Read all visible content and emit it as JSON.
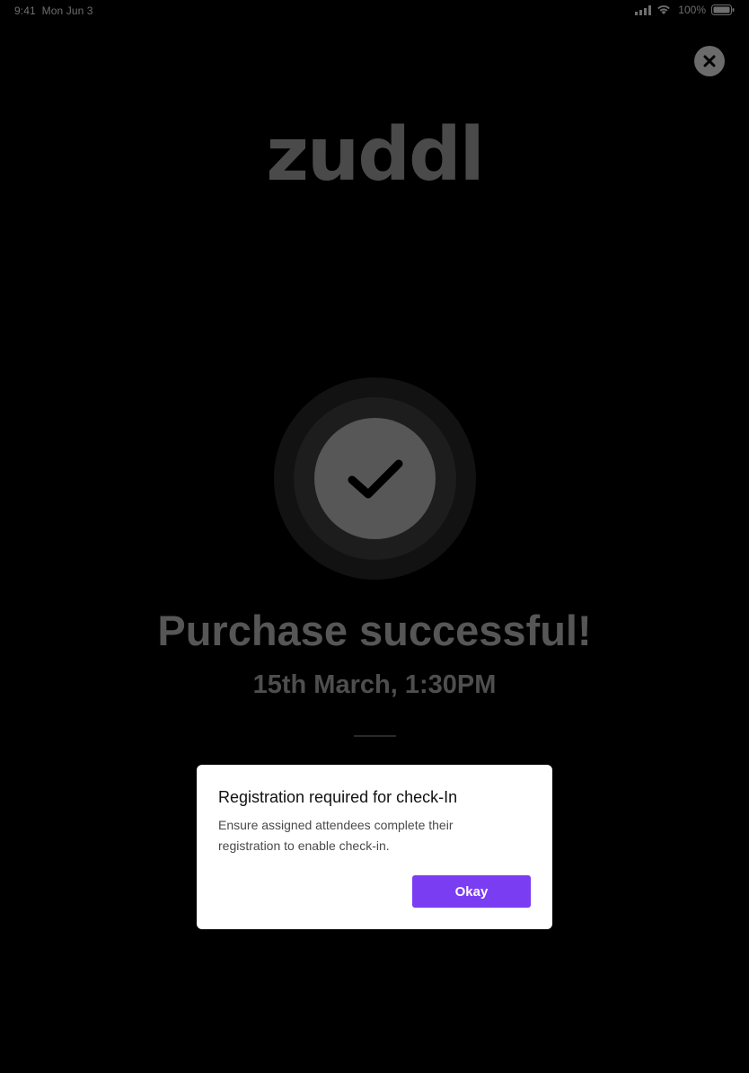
{
  "status_bar": {
    "time": "9:41",
    "date": "Mon Jun 3",
    "battery": "100%",
    "icons": [
      "signal-icon",
      "wifi-icon",
      "battery-icon"
    ]
  },
  "header": {
    "close_icon": "close-icon",
    "logo_text": "zuddl"
  },
  "success": {
    "icon": "checkmark-icon",
    "title": "Purchase successful!",
    "date_time": "15th March, 1:30PM"
  },
  "modal": {
    "title": "Registration required for check-In",
    "body": "Ensure assigned attendees complete their registration to enable check-in.",
    "okay_label": "Okay"
  },
  "colors": {
    "background": "#000000",
    "accent": "#7a3df2",
    "modal_background": "#ffffff"
  }
}
